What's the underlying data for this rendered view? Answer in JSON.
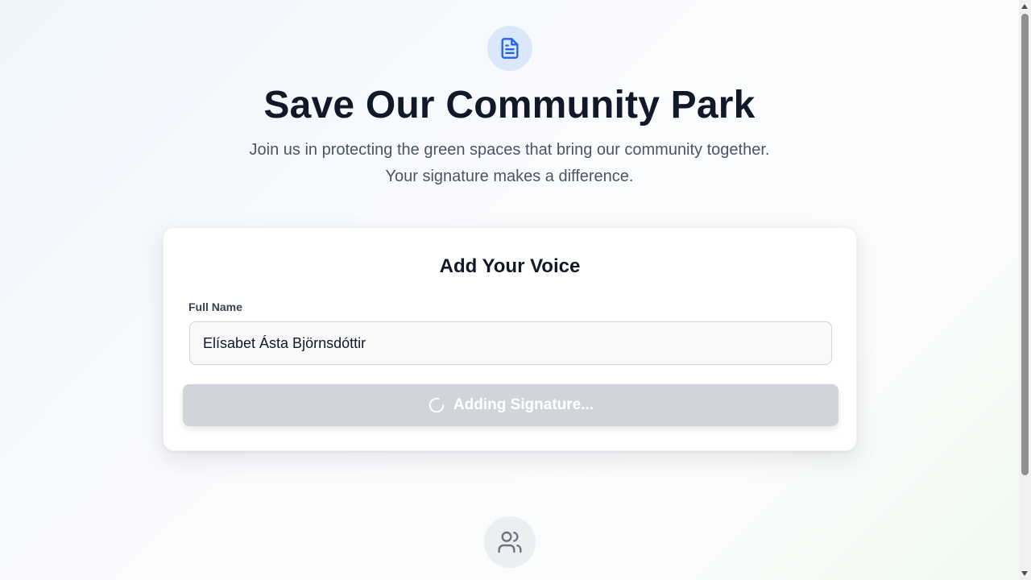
{
  "header": {
    "icon": "document-icon",
    "title": "Save Our Community Park",
    "subtitle_line1": "Join us in protecting the green spaces that bring our community together.",
    "subtitle_line2": "Your signature makes a difference."
  },
  "form": {
    "title": "Add Your Voice",
    "name_label": "Full Name",
    "name_value": "Elísabet Ásta Björnsdóttir",
    "submit_label": "Adding Signature...",
    "submit_state": "loading",
    "spinner_icon": "spinner-icon"
  },
  "footer": {
    "icon": "users-icon"
  },
  "colors": {
    "accent": "#2563eb",
    "icon_bg": "#dbe8fb",
    "button_disabled": "#d1d5db",
    "title_text": "#111827"
  }
}
